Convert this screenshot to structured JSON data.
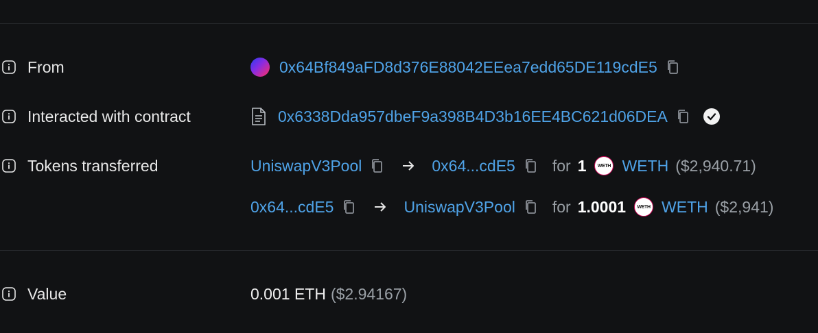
{
  "from": {
    "label": "From",
    "address": "0x64Bf849aFD8d376E88042EEea7edd65DE119cdE5"
  },
  "contract": {
    "label": "Interacted with contract",
    "address": "0x6338Dda957dbeF9a398B4D3b16EE4BC621d06DEA"
  },
  "tokens": {
    "label": "Tokens transferred",
    "transfers": [
      {
        "from": "UniswapV3Pool",
        "to": "0x64...cdE5",
        "for_word": "for",
        "amount": "1",
        "token_icon_text": "WETH",
        "token": "WETH",
        "usd": "($2,940.71)"
      },
      {
        "from": "0x64...cdE5",
        "to": "UniswapV3Pool",
        "for_word": "for",
        "amount": "1.0001",
        "token_icon_text": "WETH",
        "token": "WETH",
        "usd": "($2,941)"
      }
    ]
  },
  "value": {
    "label": "Value",
    "amount": "0.001 ETH",
    "usd": "($2.94167)"
  },
  "colors": {
    "background": "#111214",
    "link": "#4fa3e8",
    "muted": "#9aa0a6",
    "divider": "#26282c"
  }
}
